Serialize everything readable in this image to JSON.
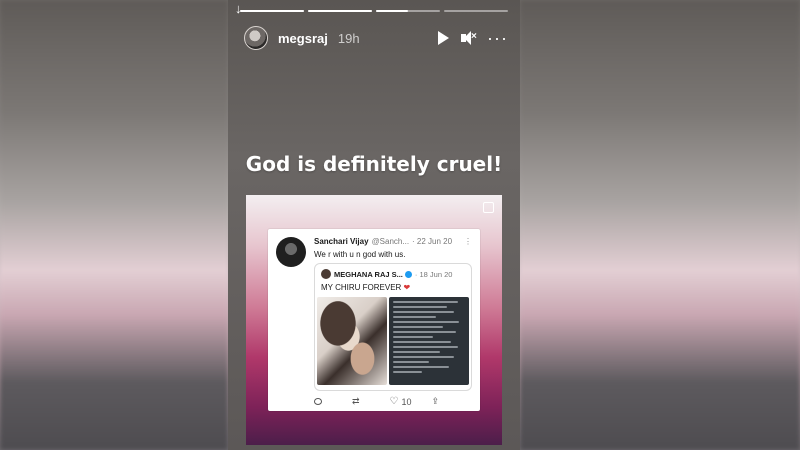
{
  "story": {
    "username": "megsraj",
    "time_ago": "19h",
    "progress": [
      1,
      1,
      0.5,
      0
    ],
    "caption": "God is definitely cruel!",
    "icons": {
      "indicator": "arrow-down-icon",
      "play": "play-icon",
      "mute": "mute-icon",
      "more": "more-icon"
    }
  },
  "tweet": {
    "author_name": "Sanchari Vijay",
    "author_handle": "@Sanch...",
    "date": "· 22 Jun 20",
    "menu": "⋮",
    "text": "We r with u n god with us.",
    "quote": {
      "author_name": "MEGHANA RAJ S...",
      "date": "· 18 Jun 20",
      "text": "MY CHIRU FOREVER",
      "heart": "❤"
    },
    "actions": {
      "retweet_glyph": "⇄",
      "like_glyph": "♡",
      "like_count": "10",
      "share_glyph": "⇪"
    }
  },
  "colors": {
    "card_gradient_mid": "#cf7b96",
    "card_gradient_dark": "#7d2258",
    "verified": "#1d9bf0",
    "heart": "#d93a3a"
  }
}
